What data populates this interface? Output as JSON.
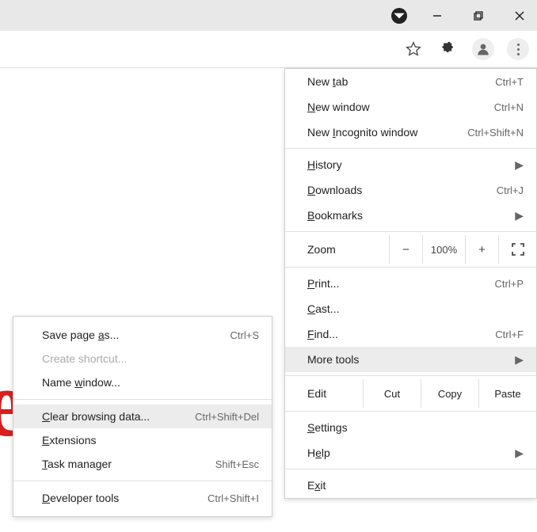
{
  "window_controls": {
    "profile_badge": "●"
  },
  "main_menu": {
    "new_tab": {
      "label": "New tab",
      "accel": "t",
      "shortcut": "Ctrl+T"
    },
    "new_window": {
      "label": "New window",
      "accel": "N",
      "shortcut": "Ctrl+N"
    },
    "incognito": {
      "label": "New Incognito window",
      "accel": "I",
      "shortcut": "Ctrl+Shift+N"
    },
    "history": {
      "label": "History",
      "accel": "H"
    },
    "downloads": {
      "label": "Downloads",
      "accel": "D",
      "shortcut": "Ctrl+J"
    },
    "bookmarks": {
      "label": "Bookmarks",
      "accel": "B"
    },
    "zoom": {
      "label": "Zoom",
      "minus": "−",
      "value": "100%",
      "plus": "+"
    },
    "print": {
      "label": "Print...",
      "accel": "P",
      "shortcut": "Ctrl+P"
    },
    "cast": {
      "label": "Cast...",
      "accel": "C"
    },
    "find": {
      "label": "Find...",
      "accel": "F",
      "shortcut": "Ctrl+F"
    },
    "more_tools": {
      "label": "More tools"
    },
    "edit": {
      "label": "Edit",
      "cut": "Cut",
      "copy": "Copy",
      "paste": "Paste"
    },
    "settings": {
      "label": "Settings",
      "accel": "S"
    },
    "help": {
      "label": "Help",
      "accel": "e"
    },
    "exit": {
      "label": "Exit",
      "accel": "x"
    }
  },
  "sub_menu": {
    "save_page": {
      "label": "Save page as...",
      "accel": "a",
      "shortcut": "Ctrl+S"
    },
    "create_shortcut": {
      "label": "Create shortcut..."
    },
    "name_window": {
      "label": "Name window...",
      "accel": "w"
    },
    "clear_data": {
      "label": "Clear browsing data...",
      "accel": "C",
      "shortcut": "Ctrl+Shift+Del"
    },
    "extensions": {
      "label": "Extensions",
      "accel": "E"
    },
    "task_manager": {
      "label": "Task manager",
      "accel": "T",
      "shortcut": "Shift+Esc"
    },
    "dev_tools": {
      "label": "Developer tools",
      "accel": "D",
      "shortcut": "Ctrl+Shift+I"
    }
  }
}
